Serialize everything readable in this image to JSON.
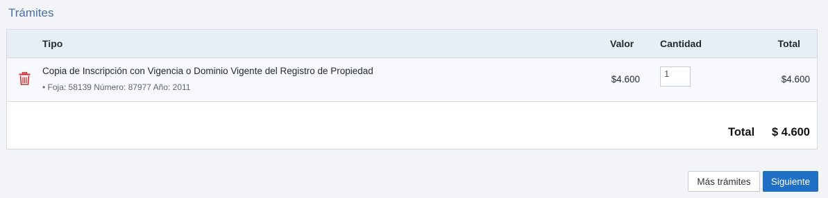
{
  "section": {
    "title": "Trámites"
  },
  "table": {
    "headers": {
      "tipo": "Tipo",
      "valor": "Valor",
      "cantidad": "Cantidad",
      "total": "Total"
    },
    "rows": [
      {
        "title": "Copia de Inscripción con Vigencia o Dominio Vigente del Registro de Propiedad",
        "detail": "• Foja: 58139 Número: 87977 Año: 2011",
        "valor": "$4.600",
        "cantidad": "1",
        "total": "$4.600",
        "delete_icon": "trash-icon"
      }
    ]
  },
  "summary": {
    "label": "Total",
    "value": "$ 4.600"
  },
  "actions": {
    "more_label": "Más trámites",
    "next_label": "Siguiente"
  },
  "colors": {
    "accent": "#1f6fc5",
    "title": "#4a6fa5",
    "delete": "#d0302f",
    "header_bg": "#e8eef6"
  }
}
